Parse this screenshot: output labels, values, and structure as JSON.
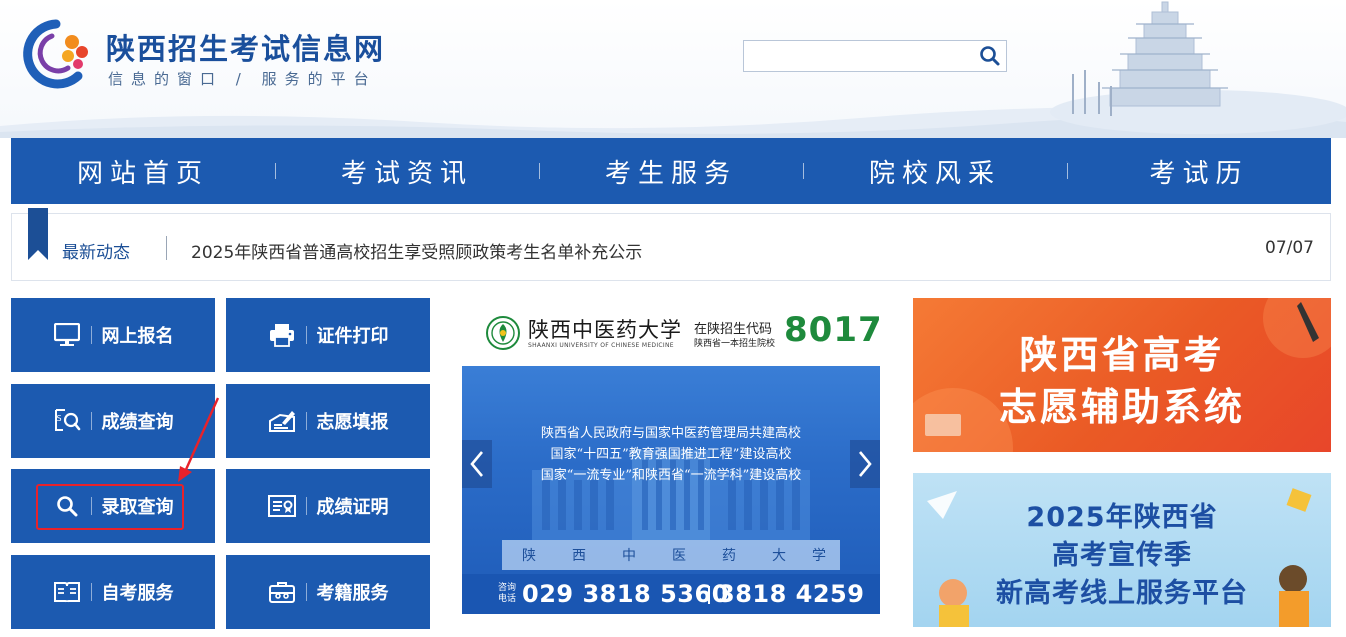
{
  "header": {
    "site_title": "陕西招生考试信息网",
    "slogan": "信息的窗口 / 服务的平台",
    "search": {
      "value": "",
      "placeholder": ""
    }
  },
  "nav": {
    "items": [
      {
        "label": "网站首页"
      },
      {
        "label": "考试资讯"
      },
      {
        "label": "考生服务"
      },
      {
        "label": "院校风采"
      },
      {
        "label": "考试历"
      }
    ]
  },
  "ticker": {
    "label": "最新动态",
    "text": "2025年陕西省普通高校招生享受照顾政策考生名单补充公示",
    "date": "07/07"
  },
  "services": {
    "tiles": [
      {
        "label": "网上报名",
        "icon": "monitor-icon"
      },
      {
        "label": "证件打印",
        "icon": "printer-icon"
      },
      {
        "label": "成绩查询",
        "icon": "score-search-icon"
      },
      {
        "label": "志愿填报",
        "icon": "pen-form-icon"
      },
      {
        "label": "录取查询",
        "icon": "search-icon"
      },
      {
        "label": "成绩证明",
        "icon": "certificate-icon"
      },
      {
        "label": "自考服务",
        "icon": "book-icon"
      },
      {
        "label": "考籍服务",
        "icon": "briefcase-icon"
      }
    ]
  },
  "university_banner": {
    "name": "陕西中医药大学",
    "name_en": "SHAANXI UNIVERSITY OF CHINESE MEDICINE",
    "code_label": "在陕招生代码",
    "code_sub": "陕西省一本招生院校",
    "code": "8017",
    "lines": [
      "陕西省人民政府与国家中医药管理局共建高校",
      "国家“十四五”教育强国推进工程”建设高校",
      "国家“一流专业”和陕西省“一流学科”建设高校"
    ],
    "contact_label": "咨询电话",
    "phone1": "029 3818 5360",
    "phone2": "3818 4259"
  },
  "banner_volunteer": {
    "line1": "陕西省高考",
    "line2": "志愿辅助系统"
  },
  "banner_publicity": {
    "line1": "2025年陕西省",
    "line2": "高考宣传季",
    "line3": "新高考线上服务平台"
  },
  "colors": {
    "brand_blue": "#1c5ab0",
    "highlight_red": "#e8222a",
    "code_green": "#1e8a3c",
    "orange": "#ea5a25"
  }
}
